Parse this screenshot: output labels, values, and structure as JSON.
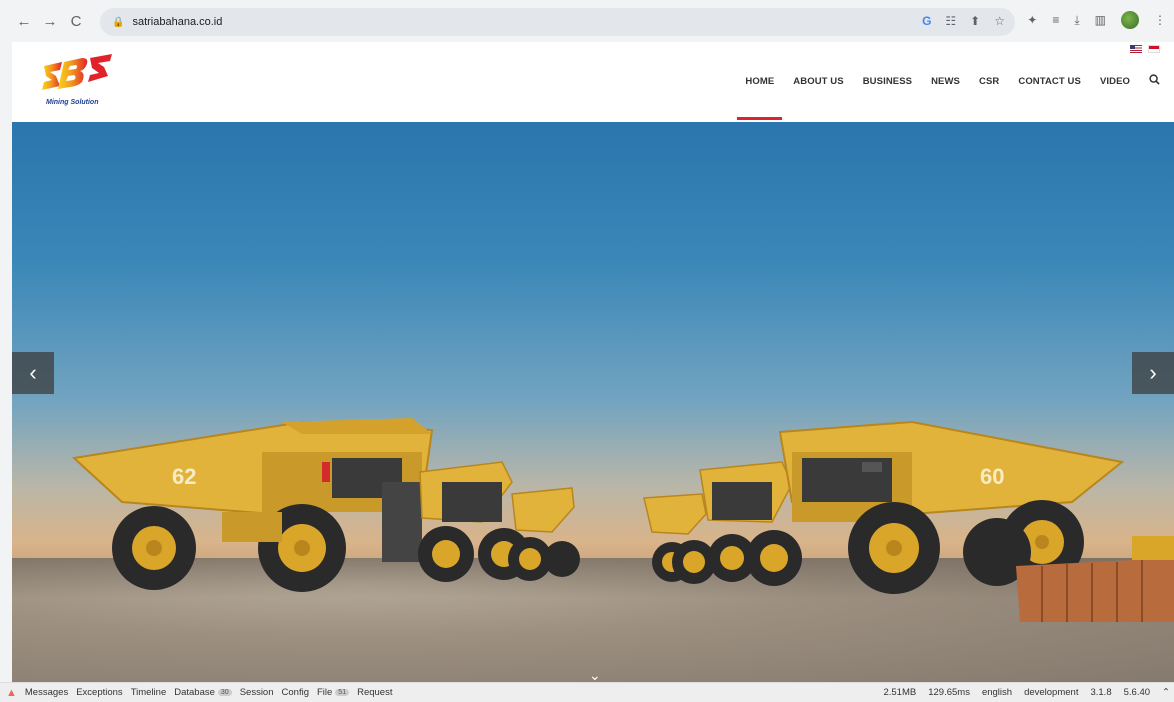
{
  "browser": {
    "url": "satriabahana.co.id",
    "back_icon": "←",
    "forward_icon": "→",
    "reload_icon": "C"
  },
  "site": {
    "logo_text": "SBS",
    "logo_tagline": "Mining Solution",
    "menu": [
      {
        "label": "HOME",
        "active": true
      },
      {
        "label": "ABOUT US",
        "active": false
      },
      {
        "label": "BUSINESS",
        "active": false
      },
      {
        "label": "NEWS",
        "active": false
      },
      {
        "label": "CSR",
        "active": false
      },
      {
        "label": "CONTACT US",
        "active": false
      },
      {
        "label": "VIDEO",
        "active": false
      }
    ],
    "hero": {
      "prev_label": "‹",
      "next_label": "›",
      "scroll_label": "⌄",
      "truck_numbers": [
        "62",
        "60"
      ]
    },
    "colors": {
      "accent": "#e0232a",
      "truck_yellow": "#e2b33a"
    }
  },
  "debugbar": {
    "tabs": [
      {
        "label": "Messages"
      },
      {
        "label": "Exceptions"
      },
      {
        "label": "Timeline"
      },
      {
        "label": "Database",
        "count": "30"
      },
      {
        "label": "Session"
      },
      {
        "label": "Config"
      },
      {
        "label": "File",
        "count": "51"
      },
      {
        "label": "Request"
      }
    ],
    "stats": [
      "2.51MB",
      "129.65ms",
      "english",
      "development",
      "3.1.8",
      "5.6.40"
    ]
  }
}
